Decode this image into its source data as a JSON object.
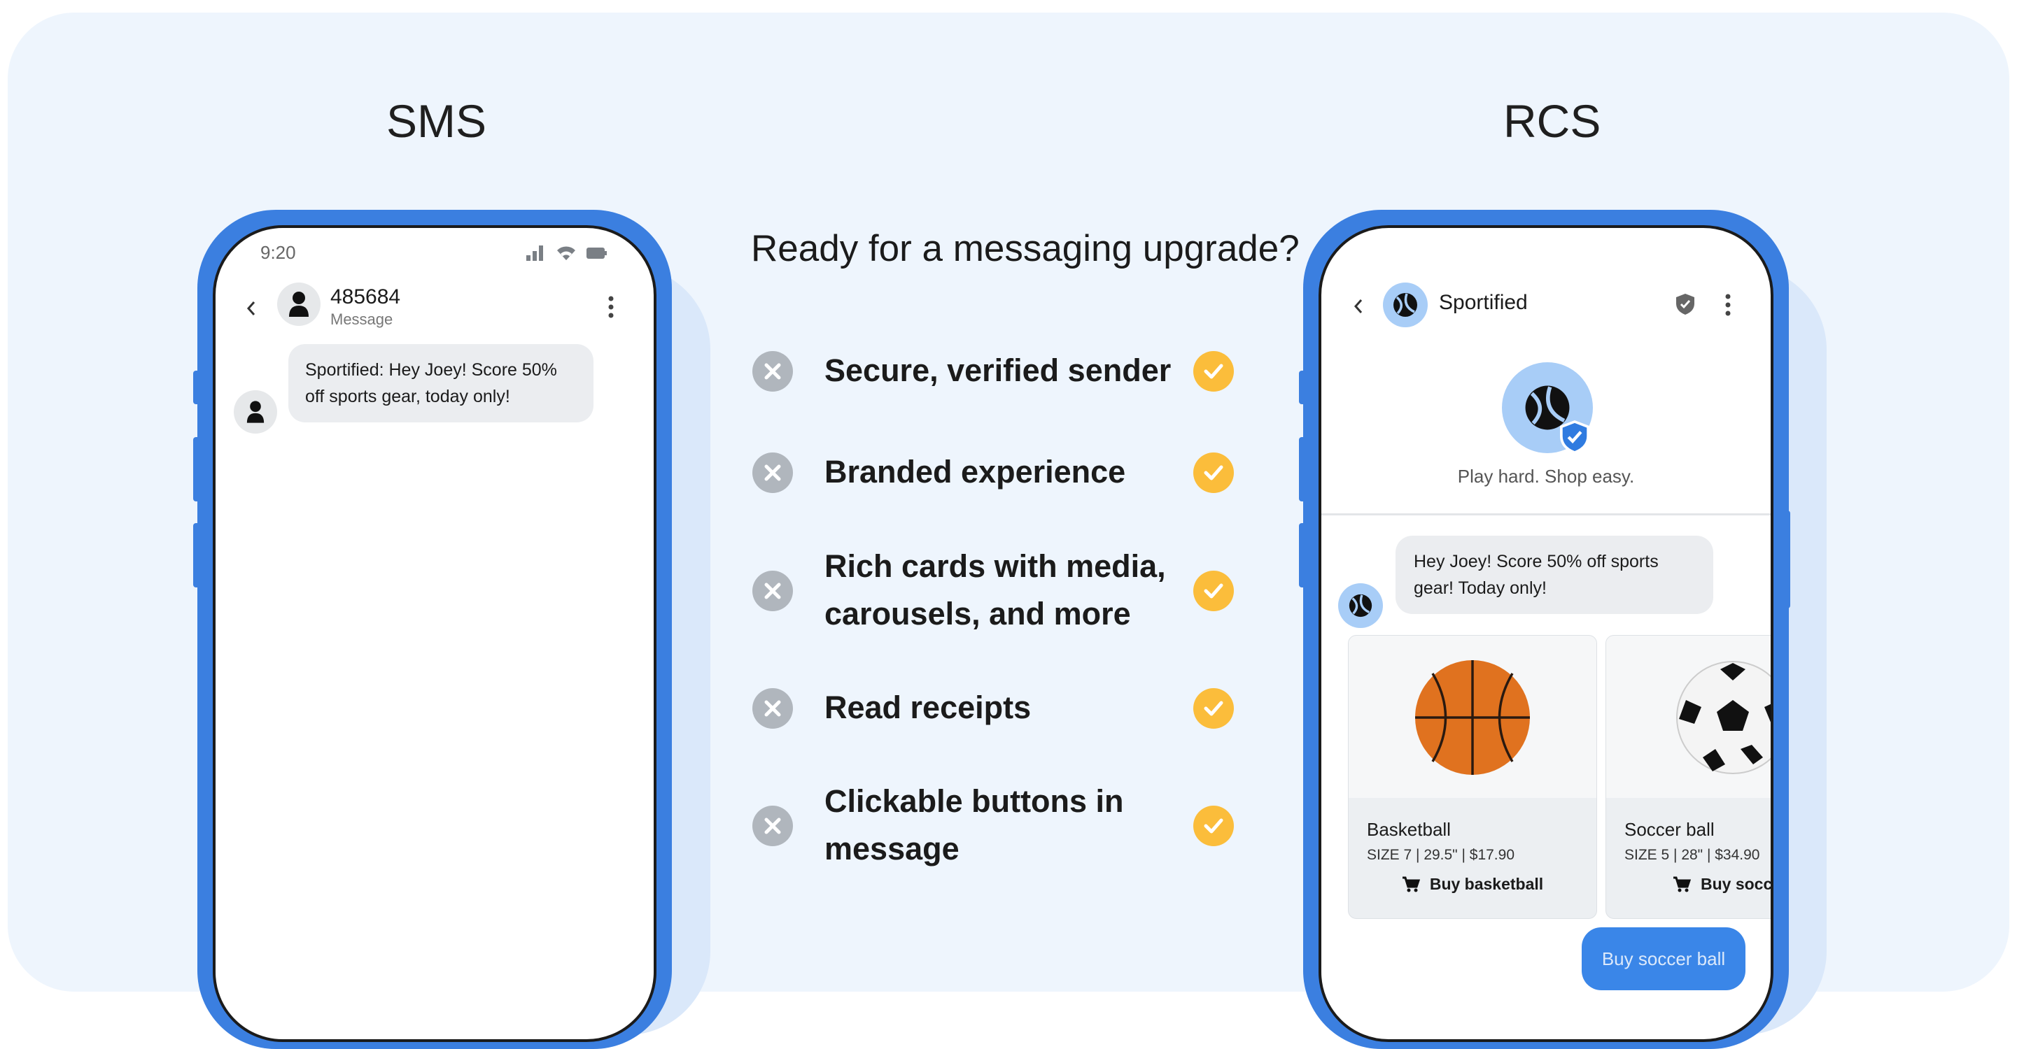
{
  "columns": {
    "left_title": "SMS",
    "right_title": "RCS"
  },
  "sms_phone": {
    "status_time": "9:20",
    "contact_name": "485684",
    "contact_sub": "Message",
    "message": "Sportified: Hey Joey! Score 50% off sports gear, today only!",
    "icons": [
      "back-arrow-icon",
      "person-icon",
      "more-vert-icon",
      "signal-icon",
      "wifi-icon",
      "battery-icon"
    ]
  },
  "center": {
    "headline": "Ready for a messaging upgrade?",
    "features": [
      {
        "line1": "Secure, verified sender",
        "line2": ""
      },
      {
        "line1": "Branded experience",
        "line2": ""
      },
      {
        "line1": "Rich cards with media,",
        "line2": "carousels, and more"
      },
      {
        "line1": "Read receipts",
        "line2": ""
      },
      {
        "line1": "Clickable buttons in",
        "line2": "message"
      }
    ],
    "icons": [
      "x-circle-icon",
      "check-circle-icon"
    ],
    "colors": {
      "x_badge": "#b0b6bd",
      "check_badge": "#fbbd3b"
    }
  },
  "rcs_phone": {
    "brand_name": "Sportified",
    "tagline": "Play hard. Shop easy.",
    "message": "Hey Joey! Score 50% off sports gear! Today only!",
    "cards": [
      {
        "title": "Basketball",
        "details": "SIZE 7 | 29.5\" | $17.90",
        "button": "Buy basketball"
      },
      {
        "title": "Soccer ball",
        "details": "SIZE 5 | 28\" | $34.90",
        "button": "Buy soccer"
      }
    ],
    "reply_button": "Buy soccer ball",
    "icons": [
      "back-arrow-icon",
      "brand-logo-icon",
      "verified-shield-icon",
      "more-vert-icon",
      "cart-icon",
      "basketball-icon",
      "soccer-ball-icon"
    ],
    "colors": {
      "accent": "#3b7fe0",
      "brand_logo_bg": "#a8cdf7",
      "reply_button": "#3a86e8"
    }
  }
}
